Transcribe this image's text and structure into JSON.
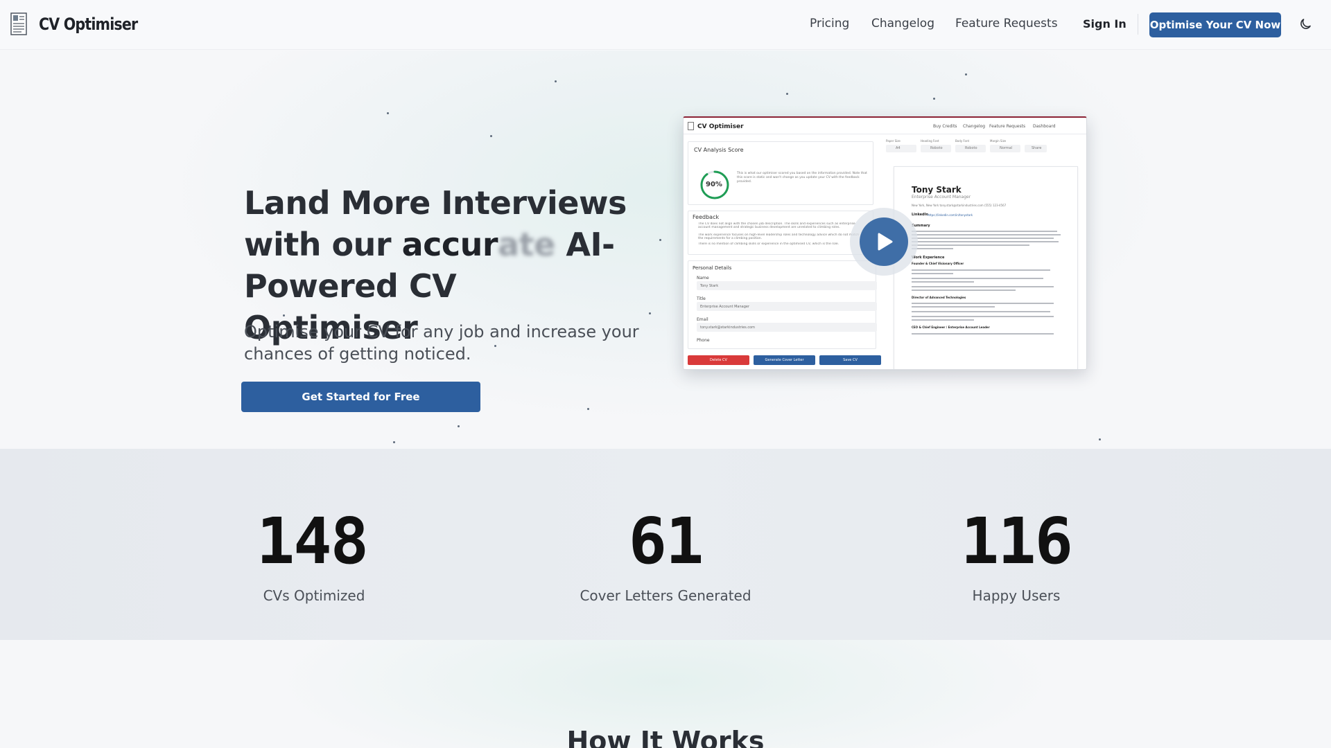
{
  "header": {
    "brand": "CV Optimiser",
    "nav": [
      "Pricing",
      "Changelog",
      "Feature Requests"
    ],
    "sign_in": "Sign In",
    "cta": "Optimise Your CV Now",
    "theme_icon": "moon-icon"
  },
  "hero": {
    "title_line1": "Land More Interviews",
    "title_line2_pre": "with our ",
    "title_typed": "accur",
    "title_typed_fade": "ate",
    "title_line2_post": " AI-",
    "title_line3": "Powered CV Optimiser",
    "subtitle": "Optimise your CV for any job and increase your chances of getting noticed.",
    "cta": "Get Started for Free"
  },
  "preview": {
    "brand": "CV Optimiser",
    "nav": [
      "Buy Credits",
      "Changelog",
      "Feature Requests",
      "Dashboard"
    ],
    "score_title": "CV Analysis Score",
    "score_value": "90%",
    "score_fraction": 0.9,
    "score_note": "This is what our optimiser scored you based on the information provided. Note that this score is static and won't change as you update your CV with the feedback provided.",
    "feedback_title": "Feedback",
    "feedback_items": [
      "The CV does not align with the chosen job description. The skills and experiences such as enterprise account management and strategic business development are unrelated to climbing roles.",
      "The work experience focuses on high-level leadership roles and technology advice which do not match the requirements for a climbing position.",
      "There is no mention of climbing skills or experience in the optimised CV, which is the role."
    ],
    "personal_title": "Personal Details",
    "fields": [
      {
        "label": "Name",
        "value": "Tony Stark"
      },
      {
        "label": "Title",
        "value": "Enterprise Account Manager"
      },
      {
        "label": "Email",
        "value": "tony.stark@starkindustries.com"
      },
      {
        "label": "Phone",
        "value": ""
      }
    ],
    "buttons": [
      "Delete CV",
      "Generate Cover Letter",
      "Save CV"
    ],
    "toolbar": [
      "Paper Size",
      "Heading Font",
      "Body Font",
      "Margin Size"
    ],
    "toolbar_values": [
      "A4",
      "Roboto",
      "Roboto",
      "Normal",
      "Share"
    ],
    "doc": {
      "name": "Tony Stark",
      "role": "Enterprise Account Manager",
      "contact": "New York, New York   tony.stark@starkindustries.com   (555) 123-4567",
      "linkedin_label": "LinkedIn",
      "linkedin": "https://linkedin.com/in/tonystark",
      "sections": [
        "Summary",
        "Work Experience",
        "Founder & Chief Visionary Officer",
        "Director of Advanced Technologies",
        "CEO & Chief Engineer / Enterprise Account Leader"
      ]
    }
  },
  "stats": [
    {
      "value": "148",
      "label": "CVs Optimized"
    },
    {
      "value": "61",
      "label": "Cover Letters Generated"
    },
    {
      "value": "116",
      "label": "Happy Users"
    }
  ],
  "how": {
    "title": "How It Works"
  },
  "colors": {
    "primary": "#2d5f9f",
    "danger": "#d93a3a",
    "score_ring": "#1f9d55"
  }
}
